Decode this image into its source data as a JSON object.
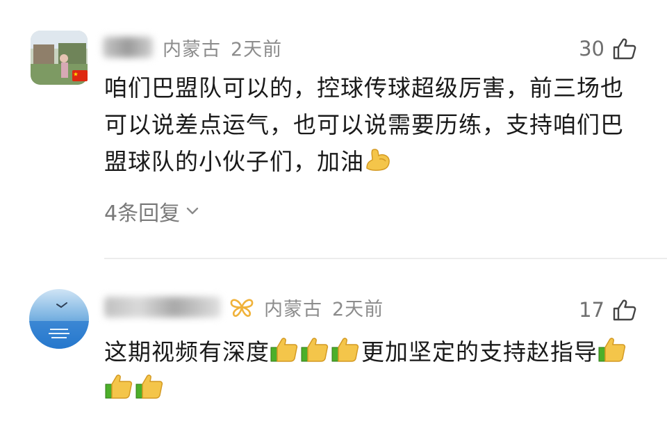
{
  "comments": [
    {
      "location": "内蒙古",
      "time": "2天前",
      "likes": "30",
      "text": "咱们巴盟队可以的，控球传球超级厉害，前三场也可以说差点运气，也可以说需要历练，支持咱们巴盟球队的小伙子们，加油",
      "emojis": [
        "flexed-biceps"
      ],
      "replies_label": "4条回复",
      "badge_icon": "china-flag-icon"
    },
    {
      "location": "内蒙古",
      "time": "2天前",
      "likes": "17",
      "text_part1": "这期视频有深度",
      "text_part2": "更加坚定的支持赵指导",
      "emojis_mid": [
        "thumbs-up",
        "thumbs-up",
        "thumbs-up"
      ],
      "emojis_end": [
        "thumbs-up",
        "thumbs-up",
        "thumbs-up"
      ],
      "badge_icon": "butterfly-icon"
    }
  ],
  "colors": {
    "meta_gray": "#8c8c8c",
    "badge_gold": "#f0b23a",
    "divider": "#ececec"
  }
}
